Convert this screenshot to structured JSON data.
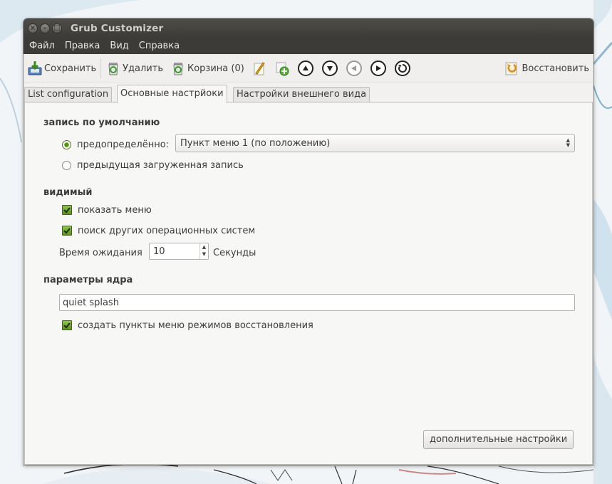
{
  "window": {
    "title": "Grub Customizer"
  },
  "menubar": {
    "items": [
      "Файл",
      "Правка",
      "Вид",
      "Справка"
    ]
  },
  "toolbar": {
    "save_label": "Сохранить",
    "delete_label": "Удалить",
    "trash_label": "Корзина (0)",
    "restore_label": "Восстановить"
  },
  "tabs": [
    {
      "label": "List configuration",
      "active": false
    },
    {
      "label": "Основные настрйоки",
      "active": true
    },
    {
      "label": "Настройки внешнего вида",
      "active": false
    }
  ],
  "default_entry": {
    "title": "запись по умолчанию",
    "predefined_label": "предопределённо:",
    "predefined_checked": true,
    "predefined_value": "Пункт меню 1 (по положению)",
    "previous_label": "предыдущая загруженная запись",
    "previous_checked": false
  },
  "visible": {
    "title": "видимый",
    "show_menu_label": "показать меню",
    "show_menu_checked": true,
    "look_for_os_label": "поиск других операционных систем",
    "look_for_os_checked": true,
    "timeout_label": "Время ожидания",
    "timeout_value": "10",
    "timeout_unit": "Секунды"
  },
  "kernel": {
    "title": "параметры ядра",
    "params_value": "quiet splash",
    "recovery_label": "создать пункты меню режимов восстановления",
    "recovery_checked": true
  },
  "advanced_button_label": "дополнительные настройки",
  "colors": {
    "titlebar": "#3d3b37",
    "accent_green": "#5d9122",
    "window_bg": "#f2f1f0"
  }
}
